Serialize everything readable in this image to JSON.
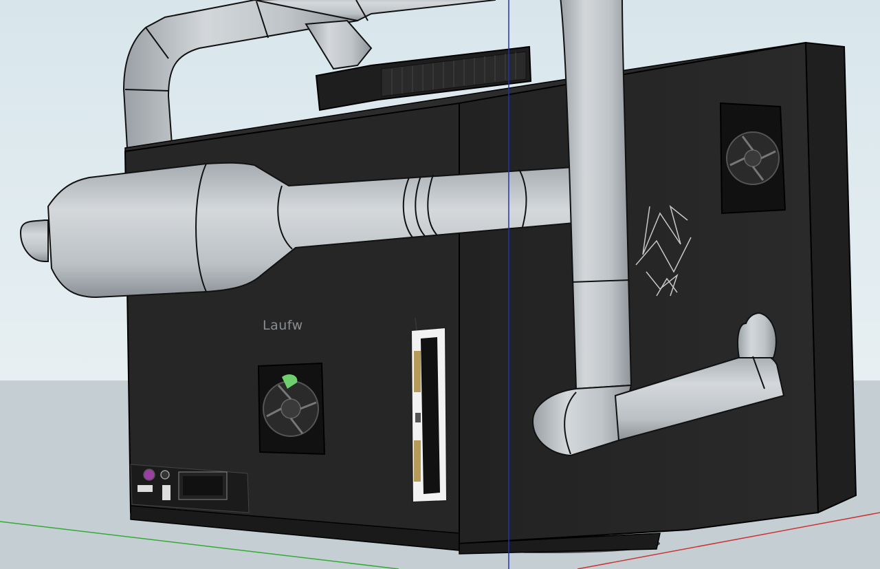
{
  "viewport": {
    "sky_color": "#d6e4ea",
    "ground_color": "#c5cfd3",
    "case_color": "#262626",
    "case_dark_color": "#1c1c1c",
    "pipe_color": "#bfc4c8",
    "axis_red": "#cc3333",
    "axis_green": "#33aa33",
    "axis_blue": "#2233aa"
  },
  "model": {
    "drive_label": "Laufw",
    "graffiti_text": "AE FES DEA"
  },
  "icons": {
    "side_fan": "fan-icon",
    "front_fan": "fan-icon",
    "expansion_card": "pci-card-icon",
    "io_panel": "port-panel-icon",
    "radiator": "radiator-icon"
  }
}
